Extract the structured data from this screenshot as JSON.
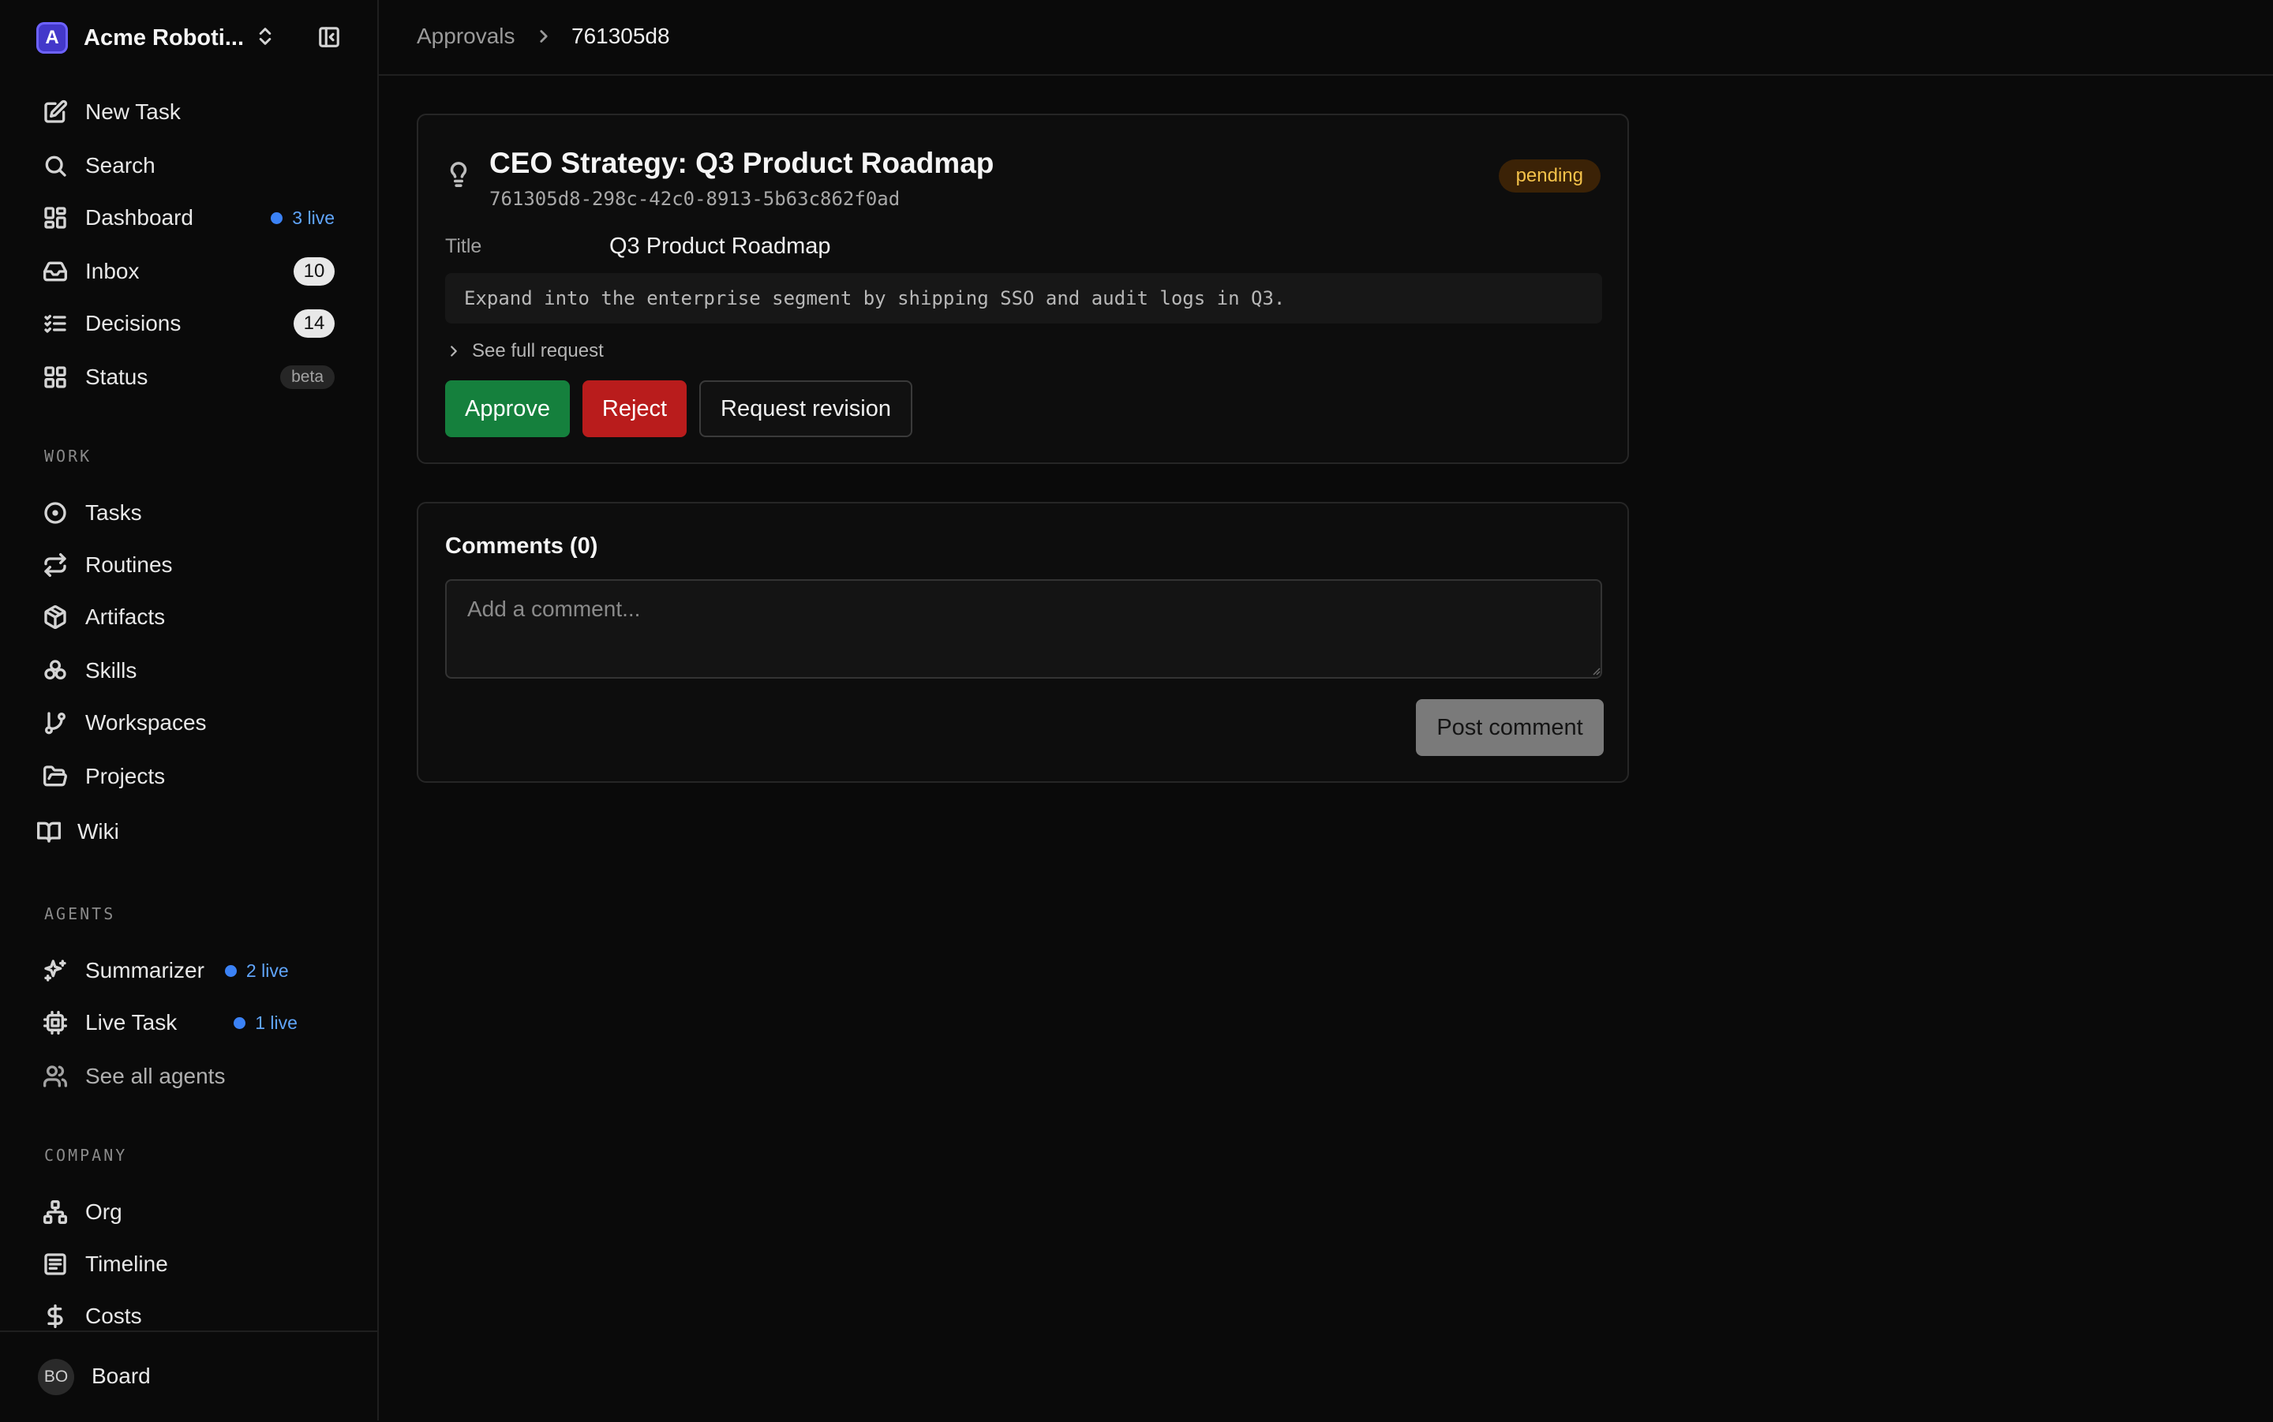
{
  "workspace": {
    "logo_letter": "A",
    "name": "Acme Roboti..."
  },
  "nav": {
    "new_task": "New Task",
    "search": "Search",
    "dashboard": {
      "label": "Dashboard",
      "live": "3 live"
    },
    "inbox": {
      "label": "Inbox",
      "count": "10"
    },
    "decisions": {
      "label": "Decisions",
      "count": "14"
    },
    "status": {
      "label": "Status",
      "badge": "beta"
    }
  },
  "work": {
    "section": "WORK",
    "tasks": "Tasks",
    "routines": "Routines",
    "artifacts": "Artifacts",
    "skills": "Skills",
    "workspaces": "Workspaces",
    "projects": "Projects",
    "wiki": "Wiki"
  },
  "agents": {
    "section": "AGENTS",
    "summarizer": {
      "label": "Summarizer",
      "live": "2 live"
    },
    "live_task": {
      "label": "Live Task",
      "live": "1 live"
    },
    "see_all": "See all agents"
  },
  "company": {
    "section": "COMPANY",
    "org": "Org",
    "timeline": "Timeline",
    "costs": "Costs"
  },
  "footer": {
    "avatar": "BO",
    "label": "Board"
  },
  "breadcrumb": {
    "parent": "Approvals",
    "current": "761305d8"
  },
  "approval": {
    "title": "CEO Strategy: Q3 Product Roadmap",
    "id": "761305d8-298c-42c0-8913-5b63c862f0ad",
    "status": "pending",
    "field_label": "Title",
    "field_value": "Q3 Product Roadmap",
    "description": "Expand into the enterprise segment by shipping SSO and audit logs in Q3.",
    "see_full": "See full request",
    "approve": "Approve",
    "reject": "Reject",
    "request_revision": "Request revision"
  },
  "comments": {
    "title": "Comments (0)",
    "placeholder": "Add a comment...",
    "post": "Post comment"
  },
  "colors": {
    "background": "#0a0a0a",
    "approve": "#15803d",
    "reject": "#b91c1c",
    "pending_text": "#f4c24a",
    "live_dot": "#3b82f6"
  }
}
